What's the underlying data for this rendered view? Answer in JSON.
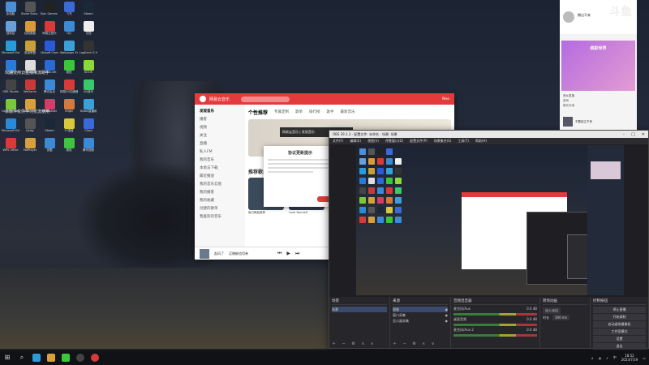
{
  "desktop": {
    "overlay_lines": [
      "欢迎使用云直播推流助手",
      "本软件仅供学习交流使用"
    ],
    "icons": [
      {
        "label": "此电脑",
        "color": "#4a8fd8"
      },
      {
        "label": "Stone Story RPG",
        "color": "#555"
      },
      {
        "label": "Epic Games Launcher",
        "color": "#222"
      },
      {
        "label": "飞书",
        "color": "#3a6ad8"
      },
      {
        "label": "Steam",
        "color": "#1b2838"
      },
      {
        "label": "回收站",
        "color": "#6aa0d8"
      },
      {
        "label": "控制面板",
        "color": "#d89a3a"
      },
      {
        "label": "网易云音乐",
        "color": "#d83a3a"
      },
      {
        "label": "QQ",
        "color": "#3a8ad8"
      },
      {
        "label": "文档",
        "color": "#eee"
      },
      {
        "label": "Microsoft Edge",
        "color": "#2a9ad8"
      },
      {
        "label": "英雄联盟",
        "color": "#c8a03a"
      },
      {
        "label": "Ubisoft Connect",
        "color": "#2a5ad8"
      },
      {
        "label": "Wallpaper Engine",
        "color": "#3aa0d8"
      },
      {
        "label": "Logitech G HUB",
        "color": "#333"
      },
      {
        "label": "迅雷",
        "color": "#2a7ad8"
      },
      {
        "label": "Genshin",
        "color": "#ddd"
      },
      {
        "label": "Battle.net",
        "color": "#2a6ad8"
      },
      {
        "label": "微信",
        "color": "#3ac83a"
      },
      {
        "label": "KOOK",
        "color": "#8ad83a"
      },
      {
        "label": "OBS Studio",
        "color": "#444"
      },
      {
        "label": "WeGame",
        "color": "#c83a3a"
      },
      {
        "label": "腾讯会议",
        "color": "#3a8ad8"
      },
      {
        "label": "网易UU加速器",
        "color": "#d83a3a"
      },
      {
        "label": "QQ音乐",
        "color": "#3ac86a"
      },
      {
        "label": "GeForce Experience",
        "color": "#7ac83a"
      },
      {
        "label": "Valorant",
        "color": "#d8a03a"
      },
      {
        "label": "WeModder",
        "color": "#d83a6a"
      },
      {
        "label": "Origin",
        "color": "#d8783a"
      },
      {
        "label": "Bilibili直播姬",
        "color": "#3aa0d8"
      },
      {
        "label": "Microsoft Edge",
        "color": "#2a8ad8"
      },
      {
        "label": "Uplay",
        "color": "#555"
      },
      {
        "label": "Steam",
        "color": "#1b2838"
      },
      {
        "label": "YY语音",
        "color": "#d8c83a"
      },
      {
        "label": "Clash",
        "color": "#3a6ad8"
      },
      {
        "label": "WPS Office",
        "color": "#d83a3a"
      },
      {
        "label": "PotPlayer",
        "color": "#d8a03a"
      },
      {
        "label": "优酷",
        "color": "#3a8ad8"
      },
      {
        "label": "微信",
        "color": "#3ac83a"
      },
      {
        "label": "腾讯视频",
        "color": "#3a8ad8"
      }
    ]
  },
  "music_window": {
    "title": "网易云音乐",
    "user": "Neo",
    "sidebar": [
      "发现音乐",
      "播客",
      "视频",
      "关注",
      "直播",
      "私人FM",
      "我的音乐",
      "本地与下载",
      "最近播放",
      "我的音乐云盘",
      "我的播客",
      "我的收藏",
      "创建的歌单",
      "我喜欢的音乐"
    ],
    "tabs": [
      "个性推荐",
      "专属定制",
      "歌单",
      "排行榜",
      "歌手",
      "最新音乐"
    ],
    "section_title": "推荐歌单",
    "cards": [
      {
        "caption": "每日歌曲推荐",
        "color": "#3a4a5a"
      },
      {
        "caption": "Love Yourself",
        "color": "#2e3a4a"
      },
      {
        "caption": "",
        "color": "#9aa6b2"
      }
    ],
    "player_title": "起风了",
    "player_artist": "买辣椒也用券"
  },
  "music_notice": "网易云音乐 | 发现音乐",
  "music_dialog": {
    "title": "协议更新提示"
  },
  "obs_window": {
    "title": "OBS 29.1.3 - 配置文件: 未命名 - 场景: 场景",
    "menu": [
      "文件(F)",
      "编辑(E)",
      "视图(V)",
      "停靠窗口(D)",
      "配置文件(P)",
      "场景集合(S)",
      "工具(T)",
      "帮助(H)"
    ],
    "scenes": {
      "header": "场景",
      "items": [
        "场景"
      ]
    },
    "sources": {
      "header": "来源",
      "items": [
        "图像",
        "窗口采集",
        "显示器采集"
      ]
    },
    "mixer": {
      "header": "音频混音器",
      "tracks": [
        {
          "name": "麦克风/Aux",
          "db": "0.0 dB"
        },
        {
          "name": "桌面音频",
          "db": "0.0 dB"
        },
        {
          "name": "麦克风/Aux 2",
          "db": "0.0 dB"
        }
      ]
    },
    "transitions": {
      "header": "转场动画",
      "type": "淡入淡出",
      "duration_label": "时长",
      "duration": "300 ms"
    },
    "controls": {
      "header": "控制按钮",
      "buttons": [
        "停止直播",
        "开始录制",
        "启动虚拟摄像机",
        "工作室模式",
        "设置",
        "退出"
      ]
    }
  },
  "live_panel": {
    "brand": "斗鱼",
    "name": "懒出不来",
    "banner_title": "缤彩世界",
    "list": [
      "美女直播",
      "游戏",
      "娱乐天地"
    ],
    "bottom_text": "不要起立不来"
  },
  "taskbar": {
    "time": "18:52",
    "date": "2023/7/19",
    "lang": "中"
  }
}
